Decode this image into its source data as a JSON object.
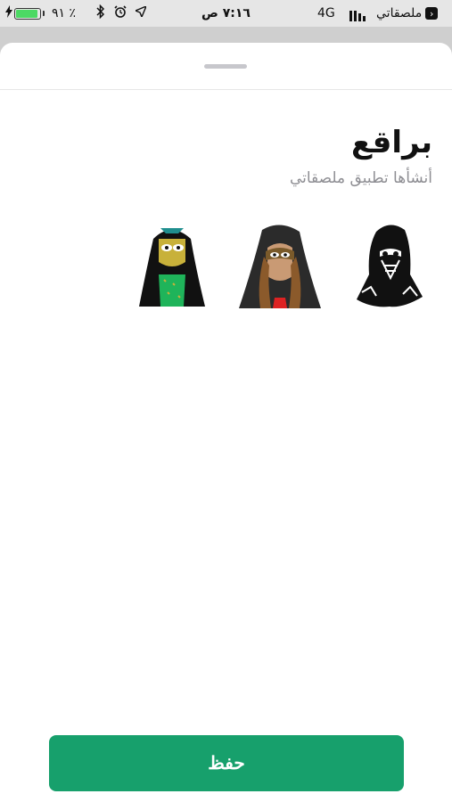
{
  "status_bar": {
    "battery_percent": "٪ ٩١",
    "time": "٧:١٦ ص",
    "network": "4G",
    "back_app": "ملصقاتي"
  },
  "sheet": {
    "title": "براقع",
    "subtitle": "أنشأها تطبيق ملصقاتي",
    "stickers": [
      {
        "name": "sticker-1"
      },
      {
        "name": "sticker-2"
      },
      {
        "name": "sticker-3"
      }
    ],
    "save_label": "حفظ"
  },
  "colors": {
    "accent": "#17a06c",
    "battery": "#4cd964"
  },
  "icons": [
    "charging-bolt-icon",
    "bluetooth-icon",
    "alarm-icon",
    "location-arrow-icon",
    "back-arrow-icon"
  ]
}
